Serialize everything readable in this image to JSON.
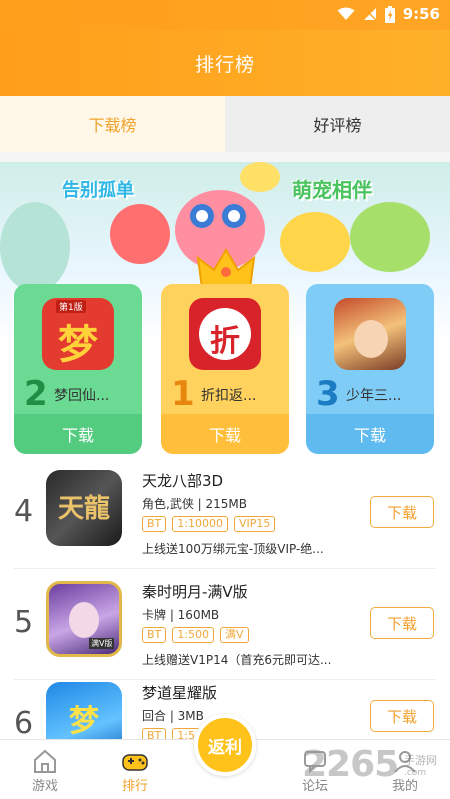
{
  "status_bar": {
    "time": "9:56"
  },
  "header": {
    "title": "排行榜"
  },
  "tabs": [
    {
      "label": "下载榜",
      "active": true
    },
    {
      "label": "好评榜",
      "active": false
    }
  ],
  "banner": {
    "text_left": "告别孤单",
    "text_right": "萌宠相伴"
  },
  "top3": [
    {
      "rank": "2",
      "name": "梦回仙...",
      "button": "下载",
      "icon_text": "梦",
      "icon_badge": "第1版"
    },
    {
      "rank": "1",
      "name": "折扣返...",
      "button": "下载",
      "icon_text": "折"
    },
    {
      "rank": "3",
      "name": "少年三...",
      "button": "下载"
    }
  ],
  "list": [
    {
      "rank": "4",
      "name": "天龙八部3D",
      "meta": "角色,武侠 | 215MB",
      "tags": [
        "BT",
        "1:10000",
        "VIP15"
      ],
      "desc": "上线送100万绑元宝-顶级VIP-绝...",
      "button": "下载",
      "icon_text": "天龍"
    },
    {
      "rank": "5",
      "name": "秦时明月-满V版",
      "meta": "卡牌 | 160MB",
      "tags": [
        "BT",
        "1:500",
        "满V"
      ],
      "desc": "上线赠送V1P14（首充6元即可达...",
      "button": "下载",
      "icon_badge": "满V版"
    },
    {
      "rank": "6",
      "name": "梦道星耀版",
      "meta": "回合 | 3MB",
      "tags": [
        "BT",
        "1:5"
      ],
      "desc": "",
      "button": "下载",
      "icon_text": "梦"
    }
  ],
  "bottom_nav": [
    {
      "label": "游戏",
      "icon": "home-icon",
      "active": false
    },
    {
      "label": "排行",
      "icon": "gamepad-icon",
      "active": true
    },
    {
      "label": "论坛",
      "icon": "forum-icon",
      "active": false
    },
    {
      "label": "我的",
      "icon": "user-icon",
      "active": false
    }
  ],
  "fab": {
    "label": "返利"
  },
  "watermark": {
    "text": "2265",
    "sub": "手游网",
    "url": ".com"
  },
  "colors": {
    "accent": "#ffa524",
    "green": "#53cc80",
    "gold": "#ffbf3a",
    "blue": "#5fbbef"
  }
}
